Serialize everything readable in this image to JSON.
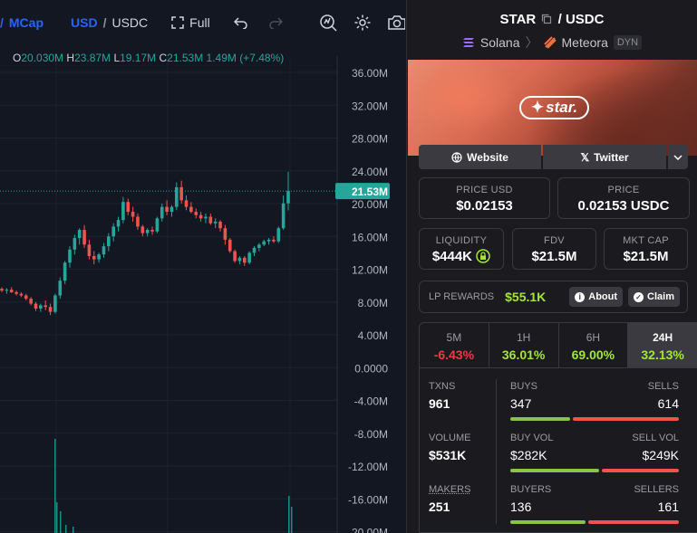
{
  "toolbar": {
    "mcap_label": "MCap",
    "usd_label": "USD",
    "separator": "/",
    "usdc_label": "USDC",
    "full_label": "Full",
    "icons": [
      "fullscreen-icon",
      "undo-icon",
      "redo-icon",
      "indicator-icon",
      "settings-icon",
      "camera-icon"
    ]
  },
  "ohlc": {
    "o_key": "O",
    "o_val": "20.030M",
    "h_key": "H",
    "h_val": "23.87M",
    "l_key": "L",
    "l_val": "19.17M",
    "c_key": "C",
    "c_val": "21.53M",
    "change": "1.49M (+7.48%)"
  },
  "chart_data": {
    "type": "candlestick",
    "y_ticks": [
      "36.00M",
      "32.00M",
      "28.00M",
      "24.00M",
      "20.00M",
      "16.00M",
      "12.00M",
      "8.00M",
      "4.00M",
      "0.0000",
      "-4.00M",
      "-8.00M",
      "-12.00M",
      "-16.00M",
      "-20.00M"
    ],
    "ylim": [
      -20,
      36
    ],
    "unit": "M",
    "last_price_label": "21.53M",
    "last_price": 21.53,
    "candles": [
      [
        9.6,
        9.8,
        9.2,
        9.4
      ],
      [
        9.4,
        9.7,
        9.0,
        9.5
      ],
      [
        9.5,
        9.8,
        9.1,
        9.2
      ],
      [
        9.2,
        9.4,
        8.8,
        9.0
      ],
      [
        9.0,
        9.2,
        8.6,
        8.8
      ],
      [
        8.8,
        9.0,
        8.2,
        8.4
      ],
      [
        8.4,
        8.6,
        7.6,
        7.8
      ],
      [
        7.8,
        8.0,
        6.9,
        7.2
      ],
      [
        7.2,
        7.8,
        6.8,
        7.6
      ],
      [
        7.6,
        8.2,
        7.0,
        7.4
      ],
      [
        7.4,
        7.8,
        6.4,
        6.8
      ],
      [
        6.8,
        9.0,
        6.6,
        8.8
      ],
      [
        8.8,
        11.0,
        8.4,
        10.6
      ],
      [
        10.6,
        13.0,
        10.2,
        12.8
      ],
      [
        12.8,
        14.8,
        12.2,
        14.4
      ],
      [
        14.4,
        16.2,
        13.8,
        15.8
      ],
      [
        15.8,
        17.0,
        15.0,
        16.8
      ],
      [
        16.8,
        17.4,
        14.6,
        15.0
      ],
      [
        15.0,
        15.6,
        13.2,
        13.6
      ],
      [
        13.6,
        14.2,
        12.6,
        13.2
      ],
      [
        13.2,
        14.0,
        12.8,
        13.8
      ],
      [
        13.8,
        15.2,
        13.4,
        14.8
      ],
      [
        14.8,
        16.4,
        14.2,
        16.0
      ],
      [
        16.0,
        17.6,
        15.4,
        17.2
      ],
      [
        17.2,
        18.4,
        16.6,
        18.0
      ],
      [
        18.0,
        20.8,
        17.6,
        20.2
      ],
      [
        20.2,
        20.6,
        18.6,
        19.0
      ],
      [
        19.0,
        19.6,
        17.8,
        18.4
      ],
      [
        18.4,
        18.8,
        16.8,
        17.2
      ],
      [
        17.2,
        17.4,
        16.0,
        16.4
      ],
      [
        16.4,
        17.0,
        16.0,
        16.8
      ],
      [
        16.8,
        17.2,
        16.2,
        16.6
      ],
      [
        16.6,
        18.4,
        16.4,
        18.2
      ],
      [
        18.2,
        20.0,
        17.8,
        19.6
      ],
      [
        19.6,
        20.4,
        18.6,
        19.0
      ],
      [
        19.0,
        19.8,
        18.4,
        19.6
      ],
      [
        19.6,
        22.6,
        19.2,
        22.0
      ],
      [
        22.0,
        22.8,
        20.0,
        20.4
      ],
      [
        20.4,
        21.0,
        19.2,
        19.6
      ],
      [
        19.6,
        20.2,
        18.8,
        19.0
      ],
      [
        19.0,
        19.4,
        18.2,
        18.6
      ],
      [
        18.6,
        19.0,
        17.8,
        18.2
      ],
      [
        18.2,
        18.8,
        17.6,
        18.4
      ],
      [
        18.4,
        18.8,
        17.4,
        17.6
      ],
      [
        17.6,
        18.2,
        17.0,
        17.8
      ],
      [
        17.8,
        18.0,
        16.6,
        17.0
      ],
      [
        17.0,
        17.4,
        15.0,
        15.6
      ],
      [
        15.6,
        15.8,
        14.0,
        14.2
      ],
      [
        14.2,
        14.4,
        12.8,
        13.0
      ],
      [
        13.0,
        13.6,
        12.6,
        13.4
      ],
      [
        13.4,
        13.6,
        12.4,
        12.8
      ],
      [
        12.8,
        14.2,
        12.6,
        14.0
      ],
      [
        14.0,
        14.8,
        13.6,
        14.6
      ],
      [
        14.6,
        15.2,
        14.2,
        15.0
      ],
      [
        15.0,
        15.6,
        14.8,
        15.4
      ],
      [
        15.4,
        15.8,
        15.0,
        15.6
      ],
      [
        15.6,
        16.0,
        15.2,
        15.4
      ],
      [
        15.4,
        17.2,
        15.2,
        17.0
      ],
      [
        17.0,
        21.0,
        16.8,
        20.03
      ],
      [
        20.03,
        23.87,
        19.17,
        21.53
      ]
    ]
  },
  "pair": {
    "base": "STAR",
    "sep": "/",
    "quote": "USDC",
    "chain": "Solana",
    "dex": "Meteora",
    "tag": "DYN",
    "logo_text": "star."
  },
  "links": {
    "website": "Website",
    "twitter": "Twitter"
  },
  "price": {
    "usd_label": "PRICE USD",
    "usd_value": "$0.02153",
    "quote_label": "PRICE",
    "quote_value": "0.02153 USDC",
    "liq_label": "LIQUIDITY",
    "liq_value": "$444K",
    "fdv_label": "FDV",
    "fdv_value": "$21.5M",
    "mcap_label": "MKT CAP",
    "mcap_value": "$21.5M"
  },
  "lp": {
    "label": "LP REWARDS",
    "value": "$55.1K",
    "about": "About",
    "claim": "Claim"
  },
  "timeframes": [
    {
      "name": "5M",
      "pct": "-6.43%"
    },
    {
      "name": "1H",
      "pct": "36.01%"
    },
    {
      "name": "6H",
      "pct": "69.00%"
    },
    {
      "name": "24H",
      "pct": "32.13%"
    }
  ],
  "stats": {
    "txns_label": "TXNS",
    "txns": "961",
    "buys_label": "BUYS",
    "buys": "347",
    "sells_label": "SELLS",
    "sells": "614",
    "volume_label": "VOLUME",
    "volume": "$531K",
    "buyvol_label": "BUY VOL",
    "buyvol": "$282K",
    "sellvol_label": "SELL VOL",
    "sellvol": "$249K",
    "makers_label": "MAKERS",
    "makers": "251",
    "buyers_label": "BUYERS",
    "buyers": "136",
    "sellers_label": "SELLERS",
    "sellers": "161"
  },
  "colors": {
    "up": "#26a69a",
    "down": "#ef5350",
    "accent": "#2962ff",
    "green_text": "#a3e635",
    "red_text": "#f23645",
    "buy_bar": "#8bc34a",
    "sell_bar": "#ef5350"
  }
}
